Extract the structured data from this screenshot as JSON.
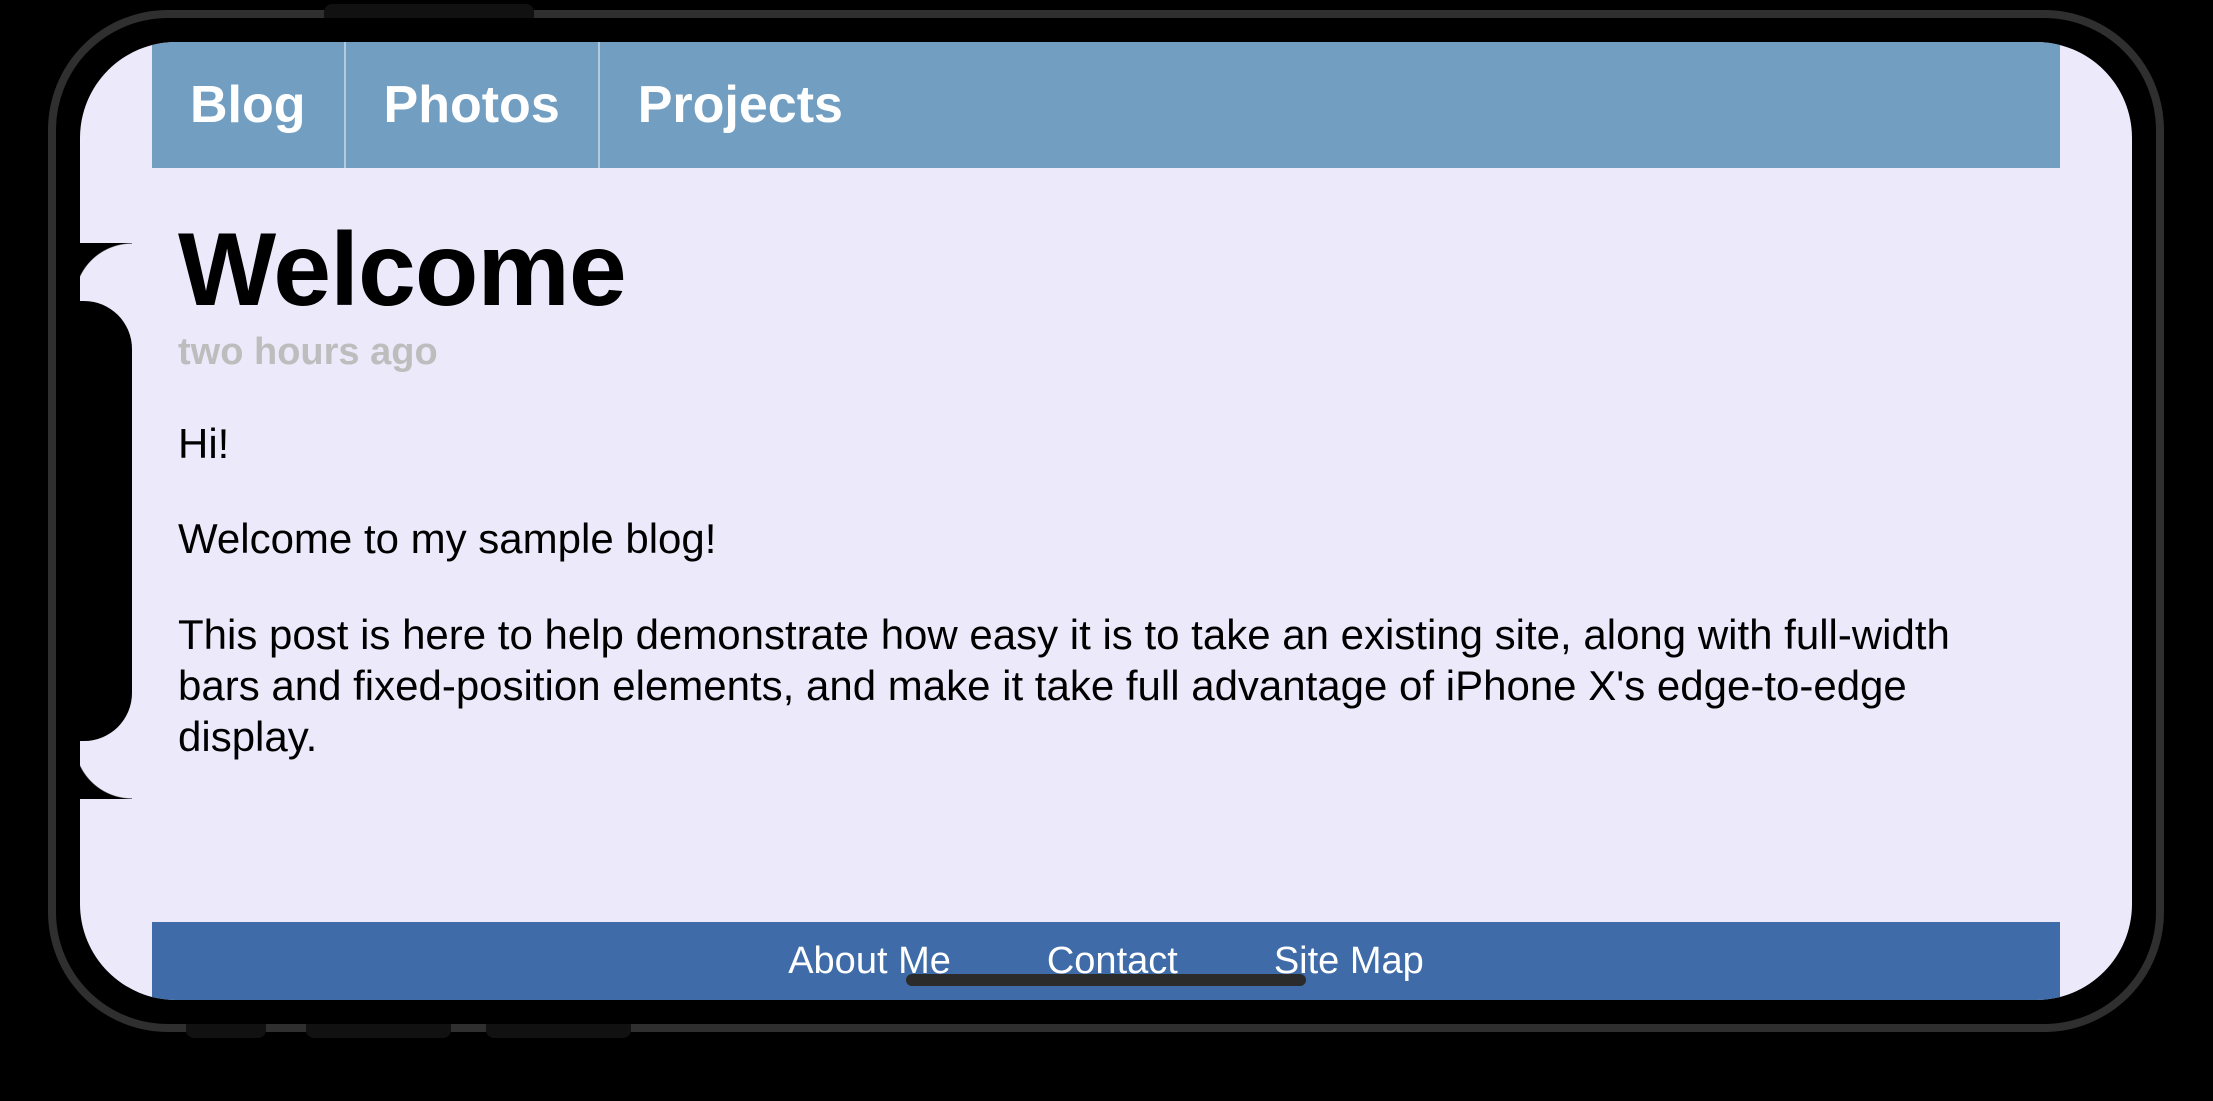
{
  "nav": {
    "items": [
      {
        "label": "Blog"
      },
      {
        "label": "Photos"
      },
      {
        "label": "Projects"
      }
    ]
  },
  "post": {
    "title": "Welcome",
    "timestamp": "two hours ago",
    "paragraphs": [
      "Hi!",
      "Welcome to my sample blog!",
      "This post is here to help demonstrate how easy it is to take an existing site, along with full-width bars and fixed-position elements, and make it take full advantage of iPhone X's edge-to-edge display."
    ]
  },
  "footer": {
    "links": [
      {
        "label": "About Me"
      },
      {
        "label": "Contact"
      },
      {
        "label": "Site Map"
      }
    ]
  },
  "colors": {
    "page_bg": "#eceafa",
    "topnav_bg": "#729ec2",
    "bottombar_bg": "#3f6ca8",
    "timestamp": "#bdbdbd"
  }
}
